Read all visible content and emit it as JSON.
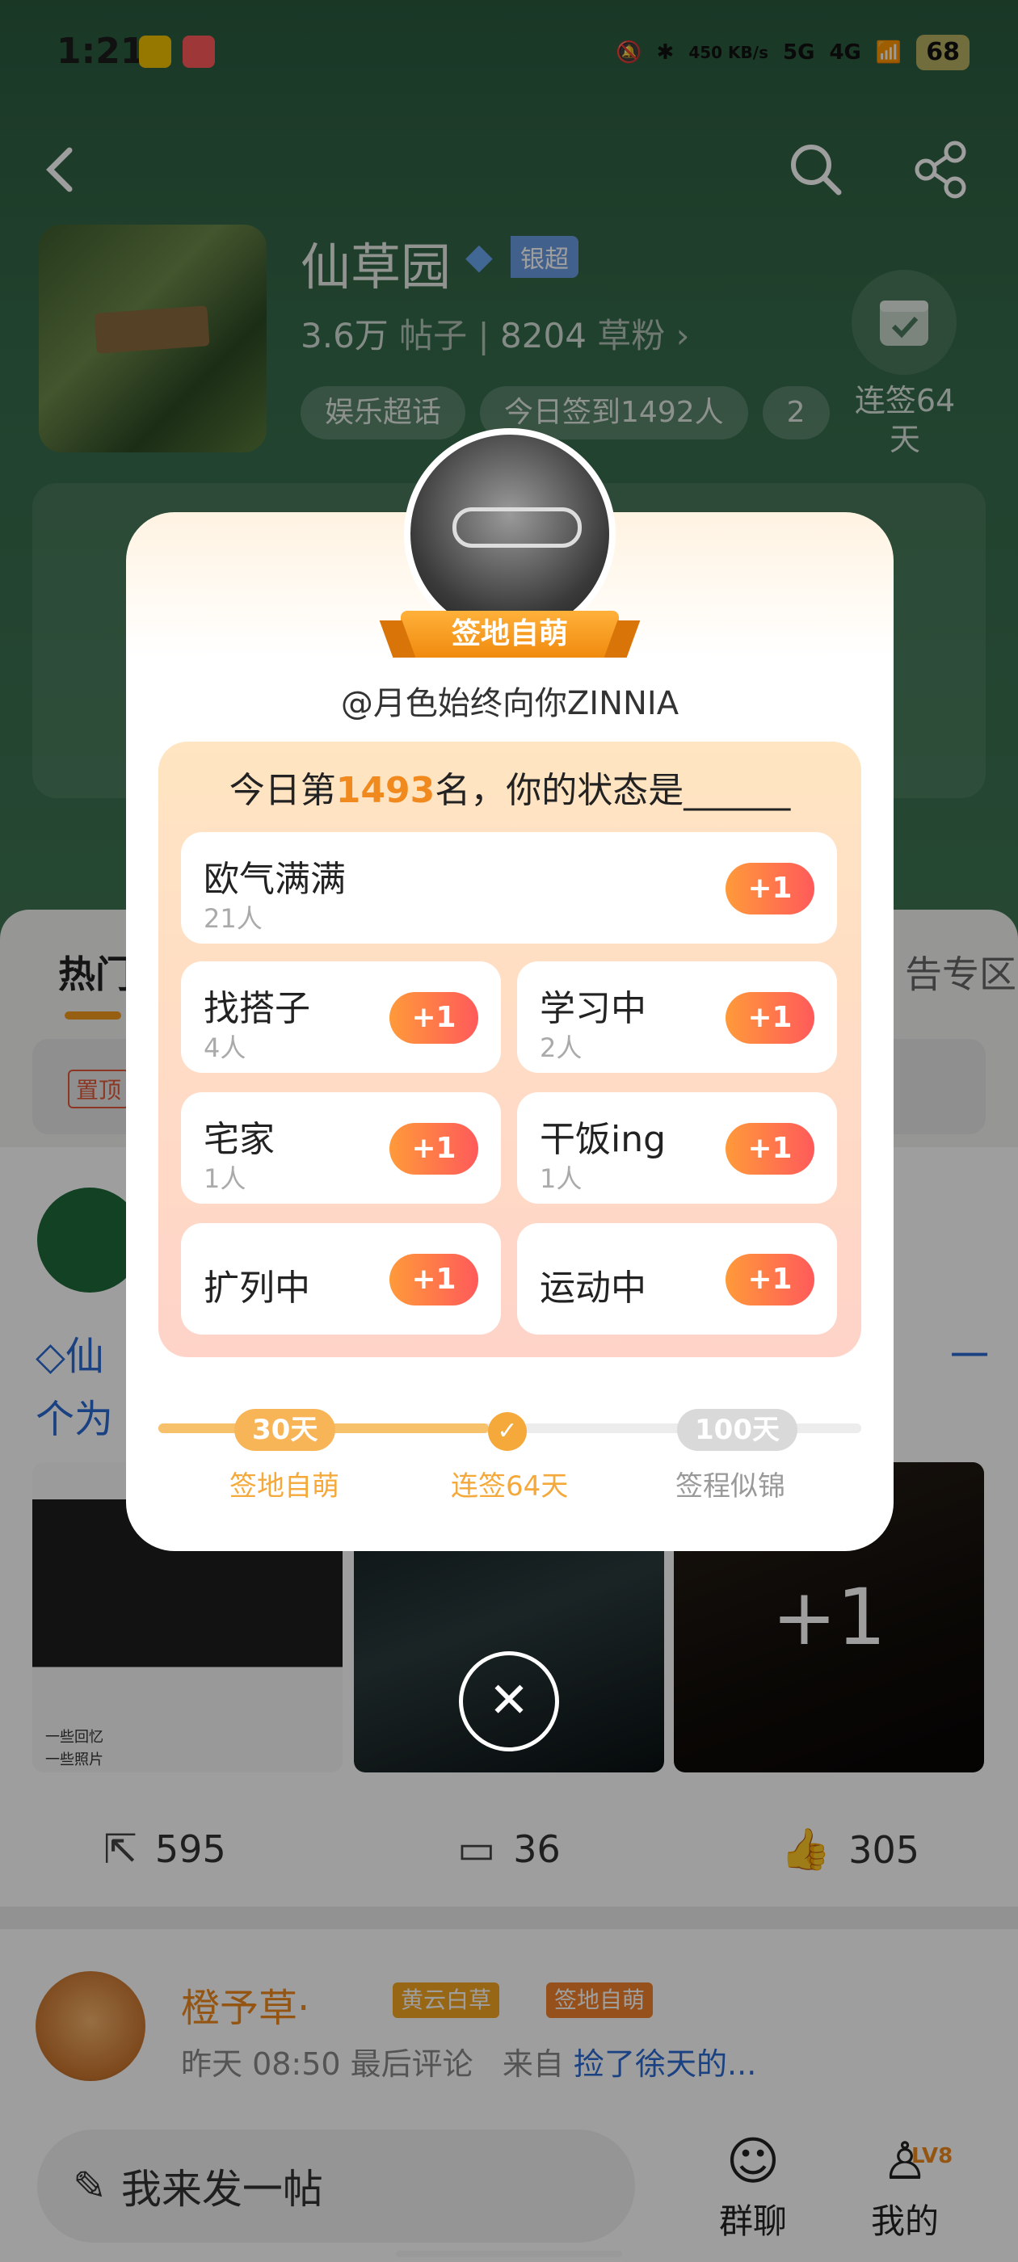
{
  "status_bar": {
    "time": "1:21",
    "net_speed": "450 KB/s",
    "signal1": "5G",
    "signal2": "4G",
    "battery": "68"
  },
  "header": {
    "title": "仙草园",
    "badge": "银超",
    "posts_count": "3.6万",
    "posts_label": "帖子",
    "fans_count": "8204",
    "fans_label": "草粉",
    "tags": [
      "娱乐超话",
      "今日签到1492人",
      "2"
    ],
    "checkin_label": "连签64天"
  },
  "tabs": {
    "hot": "热门",
    "right": "告专区"
  },
  "pinned": {
    "label": "置顶"
  },
  "post1": {
    "title_prefix": "仙",
    "title_suffix": "一",
    "title_line2": "个为",
    "thumb_caption1": "一些回忆",
    "thumb_caption2": "一些照片",
    "more_count": "+1",
    "share_count": "595",
    "comment_count": "36",
    "like_count": "305"
  },
  "post2": {
    "author": "橙予草·",
    "badge_level": "黄云白草",
    "badge_checkin": "签地自萌",
    "time": "昨天 08:50 最后评论",
    "from_label": "来自",
    "from_source": "捡了徐天的..."
  },
  "bottom": {
    "composer_placeholder": "我来发一帖",
    "group_chat": "群聊",
    "mine": "我的",
    "level": "LV8"
  },
  "modal": {
    "ribbon": "签地自萌",
    "username": "@月色始终向你ZINNIA",
    "question_prefix": "今日第",
    "rank": "1493",
    "question_suffix": "名，你的状态是______",
    "options": [
      {
        "label": "欧气满满",
        "count": "21人",
        "button": "+1"
      },
      {
        "label": "找搭子",
        "count": "4人",
        "button": "+1"
      },
      {
        "label": "学习中",
        "count": "2人",
        "button": "+1"
      },
      {
        "label": "宅家",
        "count": "1人",
        "button": "+1"
      },
      {
        "label": "干饭ing",
        "count": "1人",
        "button": "+1"
      },
      {
        "label": "扩列中",
        "count": "",
        "button": "+1"
      },
      {
        "label": "运动中",
        "count": "",
        "button": "+1"
      }
    ],
    "progress": {
      "current_streak": 64,
      "max_days": 100,
      "milestones": [
        {
          "badge": "30天",
          "label": "签地自萌"
        },
        {
          "label": "连签64天"
        },
        {
          "badge": "100天",
          "label": "签程似锦"
        }
      ]
    },
    "colors": {
      "accent": "#f08a1e",
      "button_start": "#ff9a3a",
      "button_end": "#ff5a5a"
    }
  }
}
